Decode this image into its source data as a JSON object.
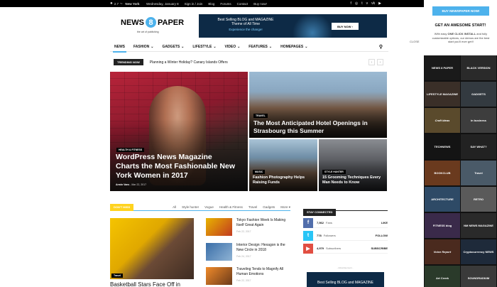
{
  "topbar": {
    "temp": "2.7",
    "temp_unit": "°C",
    "city": "New York",
    "date": "Wednesday, January 8",
    "links": [
      "Sign in / Join",
      "Blog",
      "Forums",
      "Contact",
      "Buy now!"
    ],
    "social_icons": [
      "facebook-icon",
      "instagram-icon",
      "twitter-icon",
      "vimeo-icon",
      "vk-icon",
      "youtube-icon"
    ]
  },
  "header": {
    "logo_left": "NEWS",
    "logo_num": "8",
    "logo_right": "PAPER",
    "tagline": "the art of publishing",
    "banner_line1": "Best Selling BLOG and MAGAZINE",
    "banner_line2": "Theme of All Time",
    "banner_line3": "Experience the change!",
    "banner_button": "BUY NOW ›"
  },
  "nav": {
    "items": [
      {
        "label": "NEWS",
        "dropdown": false
      },
      {
        "label": "FASHION",
        "dropdown": true
      },
      {
        "label": "GADGETS",
        "dropdown": true
      },
      {
        "label": "LIFESTYLE",
        "dropdown": true
      },
      {
        "label": "VIDEO",
        "dropdown": true
      },
      {
        "label": "FEATURES",
        "dropdown": true
      },
      {
        "label": "HOMEPAGES",
        "dropdown": true
      }
    ],
    "active_index": 0
  },
  "trending": {
    "label": "TRENDING NOW",
    "headline": "Planning a Winter Holiday? Canary Islands Offers"
  },
  "featured": [
    {
      "category": "HEALTH & FITNESS",
      "title": "WordPress News Magazine Charts the Most Fashionable New York Women in 2017",
      "author": "Armin Vans",
      "date": "Mar 22, 2017"
    },
    {
      "category": "TRAVEL",
      "title": "The Most Anticipated Hotel Openings in Strasbourg this Summer"
    },
    {
      "category": "MUSIC",
      "title": "Fashion Photography Helps Raising Funds"
    },
    {
      "category": "STYLE HUNTER",
      "title": "15 Grooming Techniques Every Man Needs to Know"
    }
  ],
  "dont_miss": {
    "label": "DON'T MISS",
    "tabs": [
      "All",
      "Style hunter",
      "Vogue",
      "Health & Fitness",
      "Travel",
      "Gadgets",
      "More ▾"
    ],
    "main_category": "Travel",
    "main_title": "Basketball Stars Face Off in",
    "items": [
      {
        "title": "Tokyo Fashion Week Is Making Itself Great Again",
        "date": "Feb 22, 2017"
      },
      {
        "title": "Interior Design: Hexagon is the New Circle in 2018",
        "date": "Feb 24, 2017"
      },
      {
        "title": "Traveling Tends to Magnify All Human Emotions",
        "date": "Feb 22, 2017"
      }
    ]
  },
  "stay_connected": {
    "label": "STAY CONNECTED",
    "rows": [
      {
        "icon": "facebook-icon",
        "count": "7,562",
        "unit": "Fans",
        "action": "LIKE",
        "color": "#516eab"
      },
      {
        "icon": "twitter-icon",
        "count": "778",
        "unit": "Followers",
        "action": "FOLLOW",
        "color": "#29c5f6"
      },
      {
        "icon": "youtube-icon",
        "count": "4,979",
        "unit": "Subscribers",
        "action": "SUBSCRIBE",
        "color": "#e14e42"
      }
    ],
    "advert_label": "- Advertisement -",
    "ad_text": "Best Selling BLOG and MAGAZINE"
  },
  "panel": {
    "buy_button": "BUY NEWSPAPER NOW!",
    "heading": "GET AN AWESOME START!",
    "desc_prefix": "With easy ",
    "desc_bold": "ONE CLICK INSTALL",
    "desc_suffix": " and fully customizable options, our demos are the best start you'll ever get!!",
    "close": "CLOSE",
    "demos": [
      "NEWS 8 PAPER",
      "BLACK VERSION",
      "LIFESTYLE MAGAZINE",
      "GADGETS",
      "Craft Ideas",
      "in business",
      "TECHNEWS",
      "SAY WHAT?",
      "BOOKCLUB",
      "Travel",
      "ARCHITECTURE",
      "RETRO",
      "FITNESS blog",
      "NM NEWS MAGAZINE",
      "Voice Report",
      "Cryptocurrency NEWS",
      "Art Creek",
      "SOUNDRADIUM"
    ]
  },
  "colors": {
    "accent": "#4db2ec",
    "dont_miss": "#ffd31f",
    "dark": "#222222"
  }
}
